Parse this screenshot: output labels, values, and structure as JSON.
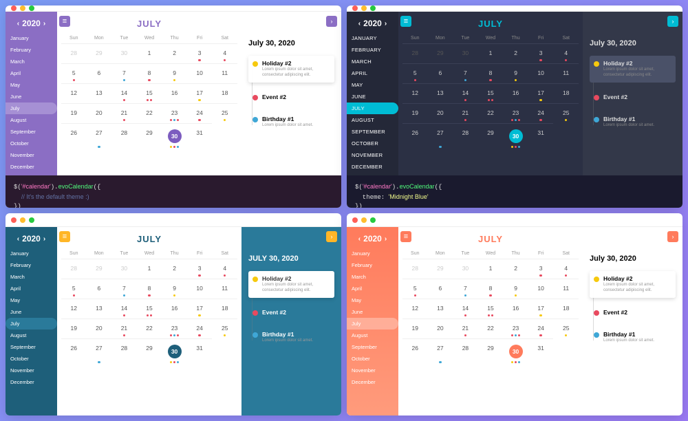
{
  "year": "2020",
  "month_title": "JULY",
  "dows": [
    "Sun",
    "Mon",
    "Tue",
    "Wed",
    "Thu",
    "Fri",
    "Sat"
  ],
  "months_full": [
    "January",
    "February",
    "March",
    "April",
    "May",
    "June",
    "July",
    "August",
    "September",
    "October",
    "November",
    "December"
  ],
  "active_month_index": 6,
  "selected_date_label": "July 30, 2020",
  "selected_date_label_upper": "JULY 30, 2020",
  "days": [
    {
      "n": 28,
      "o": true
    },
    {
      "n": 29,
      "o": true
    },
    {
      "n": 30,
      "o": true
    },
    {
      "n": 1
    },
    {
      "n": 2
    },
    {
      "n": 3,
      "d": [
        "#e84a5f"
      ]
    },
    {
      "n": 4,
      "d": [
        "#e84a5f"
      ]
    },
    {
      "n": 5,
      "d": [
        "#e84a5f"
      ]
    },
    {
      "n": 6
    },
    {
      "n": 7,
      "d": [
        "#3fa7d6"
      ]
    },
    {
      "n": 8,
      "d": [
        "#e84a5f"
      ]
    },
    {
      "n": 9,
      "d": [
        "#f6c90e"
      ]
    },
    {
      "n": 10
    },
    {
      "n": 11
    },
    {
      "n": 12
    },
    {
      "n": 13
    },
    {
      "n": 14,
      "d": [
        "#e84a5f"
      ]
    },
    {
      "n": 15,
      "d": [
        "#e84a5f",
        "#e84a5f"
      ]
    },
    {
      "n": 16
    },
    {
      "n": 17,
      "d": [
        "#f6c90e"
      ]
    },
    {
      "n": 18
    },
    {
      "n": 19
    },
    {
      "n": 20
    },
    {
      "n": 21,
      "d": [
        "#e84a5f"
      ]
    },
    {
      "n": 22
    },
    {
      "n": 23,
      "d": [
        "#e84a5f",
        "#3fa7d6",
        "#e84a5f"
      ]
    },
    {
      "n": 24,
      "d": [
        "#e84a5f"
      ]
    },
    {
      "n": 25,
      "d": [
        "#f6c90e"
      ]
    },
    {
      "n": 26
    },
    {
      "n": 27,
      "d": [
        "#3fa7d6"
      ]
    },
    {
      "n": 28
    },
    {
      "n": 29
    },
    {
      "n": 30,
      "sel": true,
      "d": [
        "#f6c90e",
        "#e84a5f",
        "#3fa7d6"
      ]
    },
    {
      "n": 31
    }
  ],
  "events": [
    {
      "title": "Holiday #2",
      "desc": "Lorem ipsum dolor sit amet, consectetur adipiscing elit.",
      "color": "#f6c90e",
      "hl": true
    },
    {
      "title": "Event #2",
      "desc": "",
      "color": "#e84a5f"
    },
    {
      "title": "Birthday #1",
      "desc": "Lorem ipsum dolor sit amet.",
      "color": "#3fa7d6"
    }
  ],
  "themes": [
    {
      "cls": "t-default",
      "code_comment": "// It's the default theme :)",
      "code_prop": ""
    },
    {
      "cls": "t-midnight",
      "code_comment": "",
      "code_prop": "theme: 'Midnight Blue'"
    },
    {
      "cls": "t-navy",
      "code_comment": "",
      "code_prop": ""
    },
    {
      "cls": "t-sunset",
      "code_comment": "",
      "code_prop": ""
    }
  ],
  "code_pre": "$('#calendar').evoCalendar({",
  "code_post": "})"
}
